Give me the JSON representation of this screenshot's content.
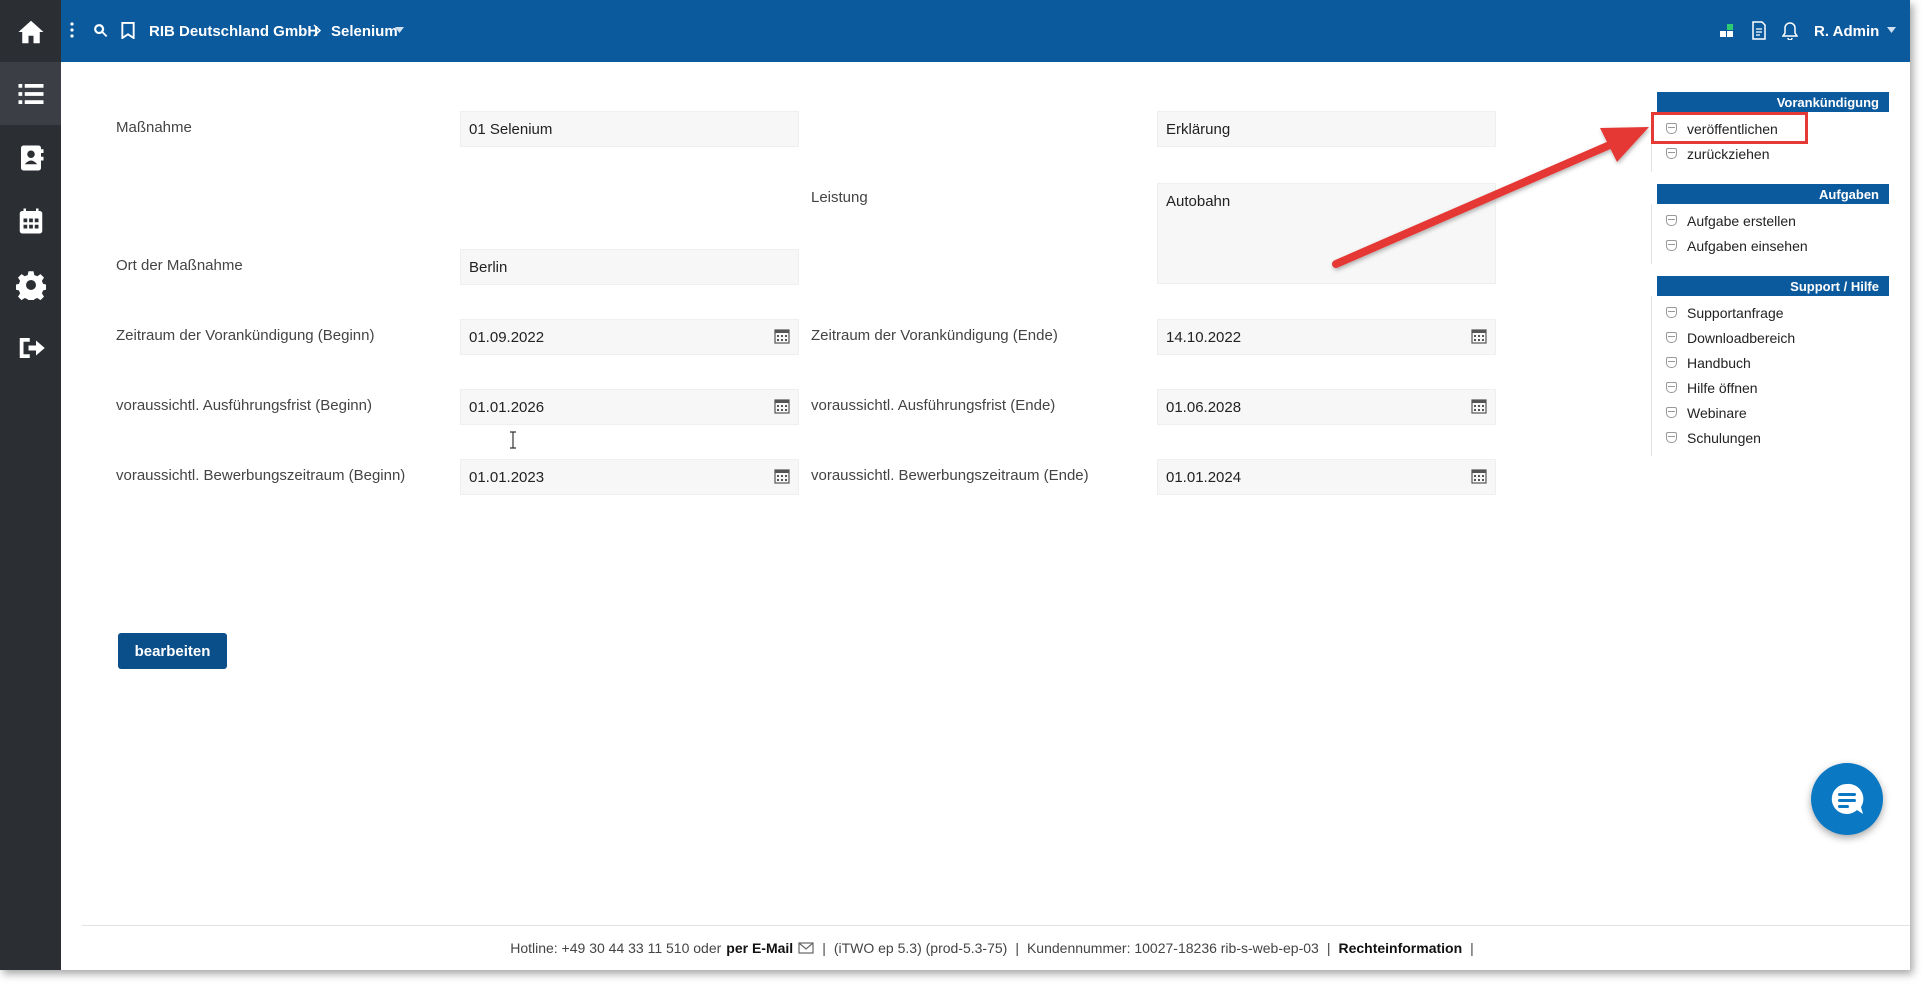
{
  "topbar": {
    "company": "RIB Deutschland GmbH",
    "project": "Selenium",
    "user": "R. Admin"
  },
  "form": {
    "massnahme_label": "Maßnahme",
    "massnahme_value": "01 Selenium",
    "erklaerung_value": "Erklärung",
    "leistung_label": "Leistung",
    "leistung_value": "Autobahn",
    "ort_label": "Ort der Maßnahme",
    "ort_value": "Berlin",
    "vk_beginn_label": "Zeitraum der Vorankündigung (Beginn)",
    "vk_beginn_value": "01.09.2022",
    "vk_ende_label": "Zeitraum der Vorankündigung (Ende)",
    "vk_ende_value": "14.10.2022",
    "af_beginn_label": "voraussichtl. Ausführungsfrist (Beginn)",
    "af_beginn_value": "01.01.2026",
    "af_ende_label": "voraussichtl. Ausführungsfrist (Ende)",
    "af_ende_value": "01.06.2028",
    "bz_beginn_label": "voraussichtl. Bewerbungszeitraum (Beginn)",
    "bz_beginn_value": "01.01.2023",
    "bz_ende_label": "voraussichtl. Bewerbungszeitraum (Ende)",
    "bz_ende_value": "01.01.2024",
    "edit_button": "bearbeiten"
  },
  "right_panel": {
    "vorankuendigung": {
      "title": "Vorankündigung",
      "items": [
        "veröffentlichen",
        "zurückziehen"
      ]
    },
    "aufgaben": {
      "title": "Aufgaben",
      "items": [
        "Aufgabe erstellen",
        "Aufgaben einsehen"
      ]
    },
    "support": {
      "title": "Support / Hilfe",
      "items": [
        "Supportanfrage",
        "Downloadbereich",
        "Handbuch",
        "Hilfe öffnen",
        "Webinare",
        "Schulungen"
      ]
    }
  },
  "footer": {
    "hotline": "Hotline: +49 30 44 33 11 510 oder",
    "email": "per E-Mail",
    "version": "(iTWO ep 5.3) (prod-5.3-75)",
    "kunde": "Kundennummer: 10027-18236 rib-s-web-ep-03",
    "recht": "Rechteinformation"
  },
  "colors": {
    "brand_blue": "#0b5a9e",
    "sidebar": "#2b2e33",
    "annotation_red": "#e53935"
  }
}
